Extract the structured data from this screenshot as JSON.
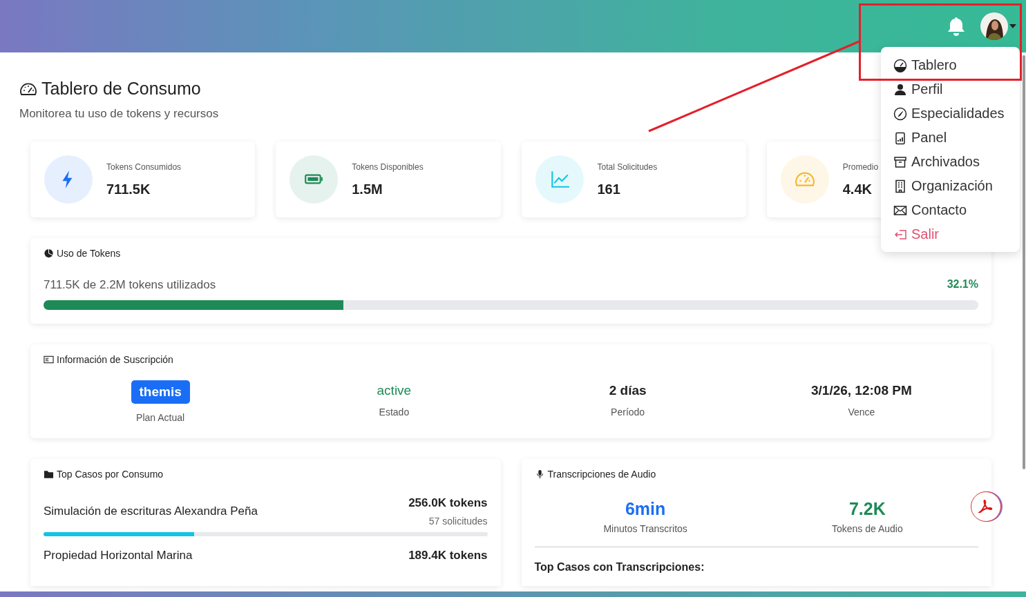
{
  "page": {
    "title": "Tablero de Consumo",
    "subtitle": "Monitorea tu uso de tokens y recursos"
  },
  "user_menu": {
    "items": [
      {
        "label": "Tablero",
        "kind": "normal"
      },
      {
        "label": "Perfil",
        "kind": "normal"
      },
      {
        "label": "Especialidades",
        "kind": "normal"
      },
      {
        "label": "Panel",
        "kind": "normal"
      },
      {
        "label": "Archivados",
        "kind": "normal"
      },
      {
        "label": "Organización",
        "kind": "normal"
      },
      {
        "label": "Contacto",
        "kind": "normal"
      },
      {
        "label": "Salir",
        "kind": "danger"
      }
    ]
  },
  "stats": [
    {
      "label": "Tokens Consumidos",
      "value": "711.5K",
      "color": "#1a6ef5"
    },
    {
      "label": "Tokens Disponibles",
      "value": "1.5M",
      "color": "#1e8a57"
    },
    {
      "label": "Total Solicitudes",
      "value": "161",
      "color": "#13c4e3"
    },
    {
      "label": "Promedio",
      "value": "4.4K",
      "color": "#f5b82e"
    }
  ],
  "usage": {
    "title": "Uso de Tokens",
    "summary": "711.5K de 2.2M tokens utilizados",
    "percent": "32.1%",
    "level": 0.321
  },
  "subscription": {
    "title": "Información de Suscripción",
    "fields": [
      {
        "kind": "badge",
        "value": "themis",
        "label": "Plan Actual"
      },
      {
        "kind": "status",
        "value": "active",
        "label": "Estado"
      },
      {
        "kind": "text",
        "value": "2 días",
        "label": "Período"
      },
      {
        "kind": "text",
        "value": "3/1/26, 12:08 PM",
        "label": "Vence"
      }
    ]
  },
  "top_cases": {
    "title": "Top Casos por Consumo",
    "rows": [
      {
        "name": "Simulación de escrituras Alexandra Peña",
        "tokens": "256.0K tokens",
        "requests": "57 solicitudes",
        "level": 0.34
      },
      {
        "name": "Propiedad Horizontal Marina",
        "tokens": "189.4K tokens"
      }
    ]
  },
  "audio": {
    "title": "Transcripciones de Audio",
    "metrics": [
      {
        "value": "6min",
        "label": "Minutos Transcritos",
        "color": "#1a6ef5"
      },
      {
        "value": "7.2K",
        "label": "Tokens de Audio",
        "color": "#1e8a57"
      }
    ],
    "subheading": "Top Casos con Transcripciones:"
  }
}
